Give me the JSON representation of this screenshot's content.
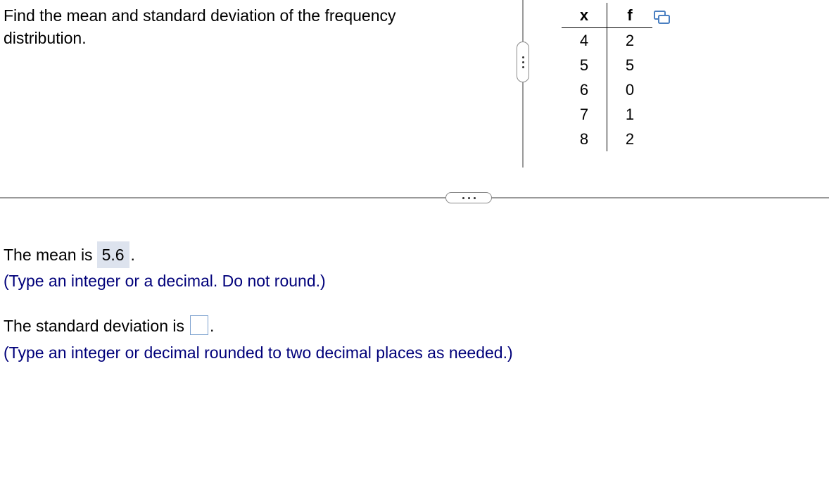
{
  "question": {
    "text": "Find the mean and standard deviation of the frequency distribution."
  },
  "table": {
    "headers": {
      "x": "x",
      "f": "f"
    },
    "rows": [
      {
        "x": "4",
        "f": "2"
      },
      {
        "x": "5",
        "f": "5"
      },
      {
        "x": "6",
        "f": "0"
      },
      {
        "x": "7",
        "f": "1"
      },
      {
        "x": "8",
        "f": "2"
      }
    ]
  },
  "answers": {
    "mean_prefix": "The mean is",
    "mean_value": "5.6",
    "mean_suffix": ".",
    "mean_hint": "(Type an integer or a decimal. Do not round.)",
    "sd_prefix": "The standard deviation is",
    "sd_value": "",
    "sd_suffix": ".",
    "sd_hint": "(Type an integer or decimal rounded to two decimal places as needed.)"
  },
  "colors": {
    "hint_text": "#00007a",
    "answer_highlight": "#dde3ee",
    "input_border": "#7da2cf",
    "copy_icon": "#4a7fc1"
  },
  "icons": {
    "copy": "copy-icon",
    "vertical_handle": "more-vertical-icon",
    "horizontal_handle": "more-horizontal-icon"
  }
}
